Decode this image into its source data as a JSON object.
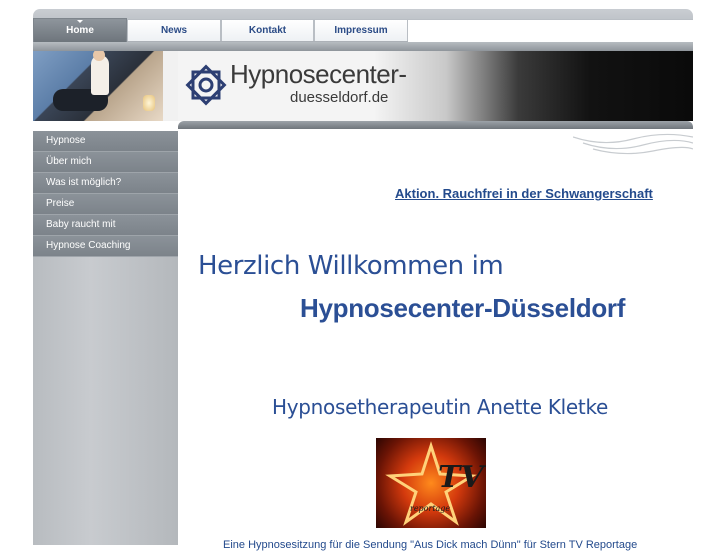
{
  "nav": {
    "tabs": [
      {
        "label": "Home",
        "active": true
      },
      {
        "label": "News",
        "active": false
      },
      {
        "label": "Kontakt",
        "active": false
      },
      {
        "label": "Impressum",
        "active": false
      }
    ]
  },
  "header": {
    "logo_title": "Hypnosecenter-",
    "logo_subtitle": "duesseldorf.de"
  },
  "sidebar": {
    "items": [
      {
        "label": "Hypnose"
      },
      {
        "label": "Über mich"
      },
      {
        "label": "Was ist möglich?"
      },
      {
        "label": "Preise"
      },
      {
        "label": "Baby raucht mit"
      },
      {
        "label": "Hypnose Coaching"
      }
    ]
  },
  "main": {
    "promo_link": "Aktion. Rauchfrei in der Schwangerschaft",
    "welcome": "Herzlich Willkommen im",
    "center_name": "Hypnosecenter-Düsseldorf",
    "therapist": "Hypnosetherapeutin Anette Kletke",
    "tv_logo_text": "TV",
    "tv_logo_sub": "reportage",
    "caption": "Eine Hypnosesitzung für die Sendung \"Aus Dick mach Dünn\" für Stern TV Reportage"
  },
  "colors": {
    "accent": "#2b4f95",
    "link": "#234a8c",
    "sidebar_item": "#7c838a",
    "topbar": "#a9aeb4"
  }
}
